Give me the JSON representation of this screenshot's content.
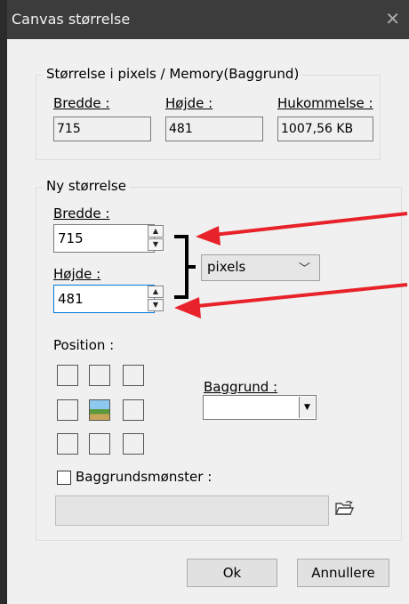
{
  "window": {
    "title": "Canvas størrelse",
    "close_icon": "close-icon"
  },
  "current_size": {
    "legend": "Størrelse i pixels / Memory(Baggrund)",
    "width_label": "Bredde :",
    "width_value": "715",
    "height_label": "Højde :",
    "height_value": "481",
    "memory_label": "Hukommelse :",
    "memory_value": "1007,56 KB"
  },
  "new_size": {
    "legend": "Ny størrelse",
    "width_label": "Bredde :",
    "width_value": "715",
    "height_label": "Højde :",
    "height_value": "481",
    "unit_selected": "pixels"
  },
  "position": {
    "label": "Position :",
    "selected_cell": "center"
  },
  "background": {
    "label": "Baggrund :",
    "selected": ""
  },
  "pattern": {
    "label": "Baggrundsmønster :",
    "checked": false,
    "path_value": ""
  },
  "buttons": {
    "ok": "Ok",
    "cancel": "Annullere"
  },
  "annotation": {
    "arrow_color": "#e8222a",
    "bracket_color": "#000000"
  }
}
